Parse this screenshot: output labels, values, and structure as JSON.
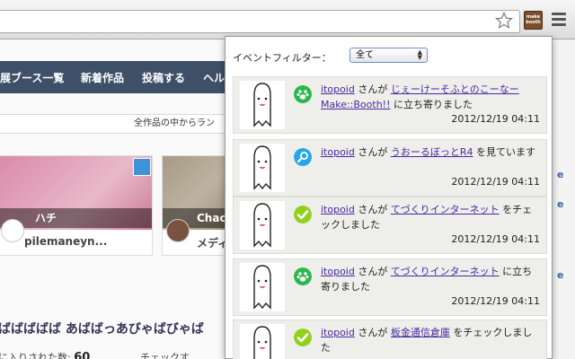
{
  "browser": {
    "extension_button_label": "make booth",
    "icons": [
      "star-icon",
      "wrench-menu-icon"
    ]
  },
  "page": {
    "nav_items": [
      "展ブース一覧",
      "新着作品",
      "投稿する",
      "ヘル"
    ],
    "ranking_text": "全作品の中からラン",
    "cards": [
      {
        "caption": "ハチ",
        "user": "pilemaneyn..."
      },
      {
        "caption": "Chac",
        "user": "メディ"
      }
    ],
    "section_title": "ばばばばば あばばっあびゃばびゃば",
    "favorites_label": "に入りされた数:",
    "favorites_count": "60",
    "check_label": "チェックす",
    "right_strip_letters": [
      "e",
      "e",
      "e"
    ]
  },
  "popup": {
    "filter_label": "イベントフィルター：",
    "filter_value": "全て",
    "events": [
      {
        "user": "itopoid",
        "mid": " さんが ",
        "target": "じぇーけーそふとのこーなーMake::Booth!!",
        "suffix": " に立ち寄りました",
        "time": "2012/12/19 04:11",
        "type": "visit",
        "icon": "paw-icon",
        "icon_color": "#2ab84a"
      },
      {
        "user": "itopoid",
        "mid": " さんが ",
        "target": "うおーるぼっとR4",
        "suffix": " を見ています",
        "time": "2012/12/19 04:11",
        "type": "view",
        "icon": "magnifier-icon",
        "icon_color": "#27a6e8"
      },
      {
        "user": "itopoid",
        "mid": " さんが ",
        "target": "てづくりインターネット",
        "suffix": " をチェックしました",
        "time": "2012/12/19 04:11",
        "type": "check",
        "icon": "checkmark-icon",
        "icon_color": "#8fd11d"
      },
      {
        "user": "itopoid",
        "mid": " さんが ",
        "target": "てづくりインターネット",
        "suffix": " に立ち寄りました",
        "time": "2012/12/19 04:11",
        "type": "visit",
        "icon": "paw-icon",
        "icon_color": "#2ab84a"
      },
      {
        "user": "itopoid",
        "mid": " さんが ",
        "target": "板金通信倉庫",
        "suffix": " をチェックしました",
        "time": "",
        "type": "check",
        "icon": "checkmark-icon",
        "icon_color": "#8fd11d"
      }
    ]
  }
}
